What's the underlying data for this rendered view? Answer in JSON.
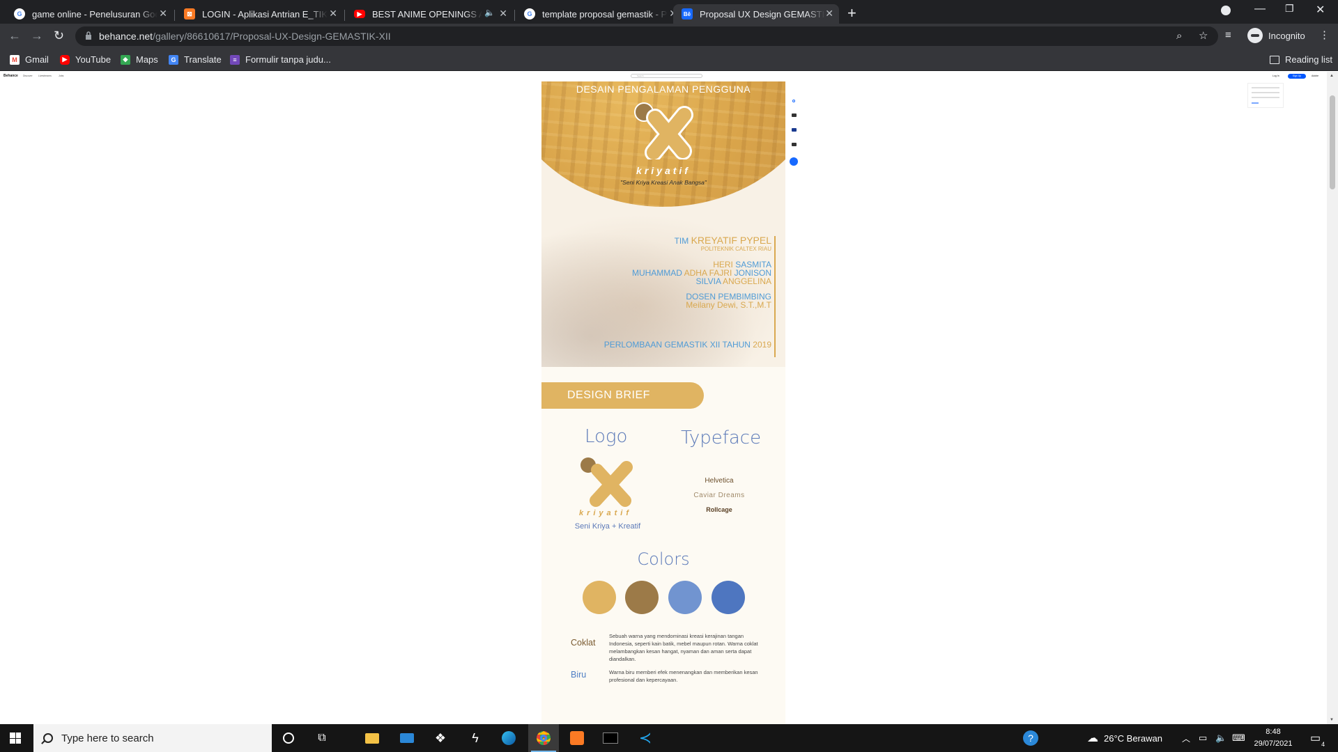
{
  "tabs": [
    {
      "title": "game online - Penelusuran Goog",
      "favicon": "google-icon"
    },
    {
      "title": "LOGIN - Aplikasi Antrian E_TIKET",
      "favicon": "xampp-icon"
    },
    {
      "title": "BEST ANIME OPENINGS AND",
      "favicon": "youtube-icon"
    },
    {
      "title": "template proposal gemastik - Pe",
      "favicon": "google-icon"
    },
    {
      "title": "Proposal UX Design GEMASTIK X",
      "favicon": "behance-icon",
      "active": true
    }
  ],
  "address": {
    "domain": "behance.net",
    "path": "/gallery/86610617/Proposal-UX-Design-GEMASTIK-XII"
  },
  "profile": {
    "label": "Incognito"
  },
  "bookmarks": [
    {
      "label": "Gmail",
      "icon": "gmail-icon"
    },
    {
      "label": "YouTube",
      "icon": "youtube-icon"
    },
    {
      "label": "Maps",
      "icon": "maps-icon"
    },
    {
      "label": "Translate",
      "icon": "translate-icon"
    },
    {
      "label": "Formulir tanpa judu...",
      "icon": "forms-icon"
    }
  ],
  "reading_list": "Reading list",
  "behance": {
    "logo": "Behance",
    "nav": [
      "Discover",
      "Livestreams",
      "Jobs"
    ],
    "search_placeholder": "Search",
    "login": "Log In",
    "signup": "Sign Up",
    "adobe": "Adobe"
  },
  "cover": {
    "heading": "DESAIN PENGALAMAN PENGGUNA",
    "brand": "kriyatif",
    "tagline": "\"Seni Kriya Kreasi Anak Bangsa\"",
    "team": {
      "tim_prefix": "TIM",
      "team_name": "KREYATIF PYPEL",
      "school": "POLITEKNIK CALTEX RIAU",
      "members": [
        {
          "first": "HERI",
          "last": "SASMITA"
        },
        {
          "first": "MUHAMMAD",
          "mid": "ADHA FAJRI",
          "last": "JONISON"
        },
        {
          "first": "SILVIA",
          "last": "ANGGELINA"
        }
      ],
      "advisor_label": "DOSEN PEMBIMBING",
      "advisor_name": "Meilany Dewi, S.T.,M.T",
      "event": "PERLOMBAAN GEMASTIK XII TAHUN",
      "year": "2019"
    }
  },
  "brief": {
    "title": "DESIGN BRIEF",
    "logo_title": "Logo",
    "logo_word": "kriyatif",
    "logo_caption": "Seni Kriya + Kreatif",
    "typeface_title": "Typeface",
    "fonts": [
      "Helvetica",
      "Caviar Dreams",
      "Rollcage"
    ],
    "colors_title": "Colors",
    "swatches": [
      "#e0b462",
      "#9c7a48",
      "#7194d0",
      "#4e76c0"
    ],
    "color_desc": [
      {
        "label": "Coklat",
        "text": "Sebuah warna yang mendominasi kreasi kerajinan tangan Indonesia, seperti kain batik, mebel maupun rotan. Warna coklat melambangkan kesan hangat, nyaman dan aman serta dapat diandalkan."
      },
      {
        "label": "Biru",
        "text": "Warna biru memberi efek menenangkan dan memberikan kesan profesional dan kepercayaan."
      }
    ]
  },
  "taskbar": {
    "search_placeholder": "Type here to search",
    "weather": "26°C  Berawan",
    "time": "8:48",
    "date": "29/07/2021",
    "notif_count": "4"
  }
}
